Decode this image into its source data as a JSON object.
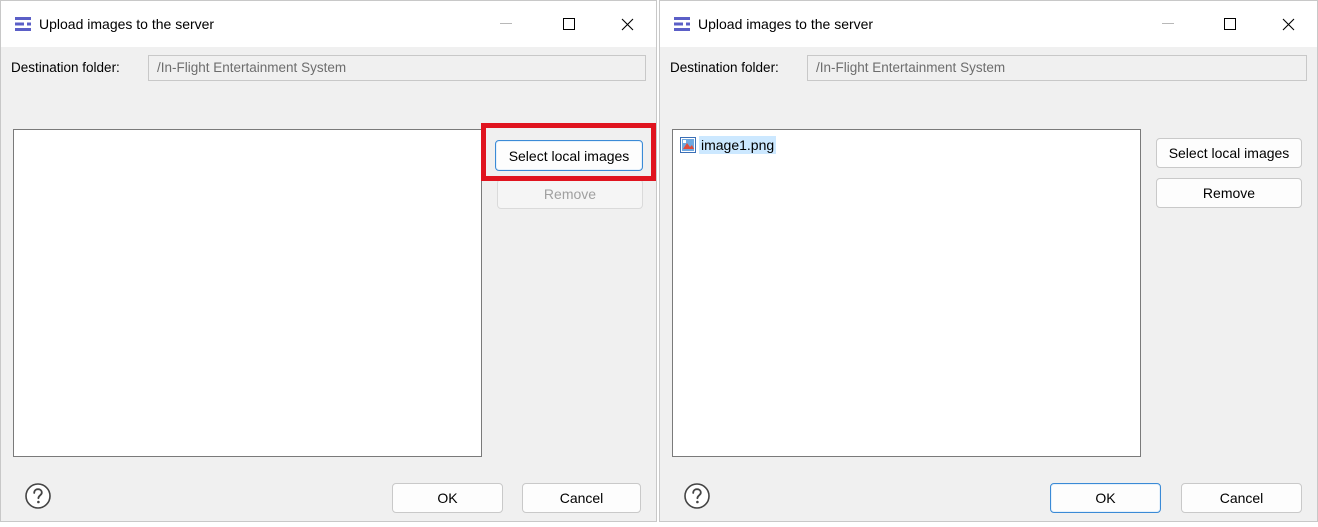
{
  "colors": {
    "accent": "#3a8ad6",
    "selection": "#cce8ff",
    "highlight": "#e0141f"
  },
  "dialogs": [
    {
      "title": "Upload images to the server",
      "dest_label": "Destination folder:",
      "dest_value": "/In-Flight Entertainment System",
      "select_label": "Select local images",
      "remove_label": "Remove",
      "ok_label": "OK",
      "cancel_label": "Cancel",
      "files": []
    },
    {
      "title": "Upload images to the server",
      "dest_label": "Destination folder:",
      "dest_value": "/In-Flight Entertainment System",
      "select_label": "Select local images",
      "remove_label": "Remove",
      "ok_label": "OK",
      "cancel_label": "Cancel",
      "files": [
        "image1.png"
      ]
    }
  ]
}
